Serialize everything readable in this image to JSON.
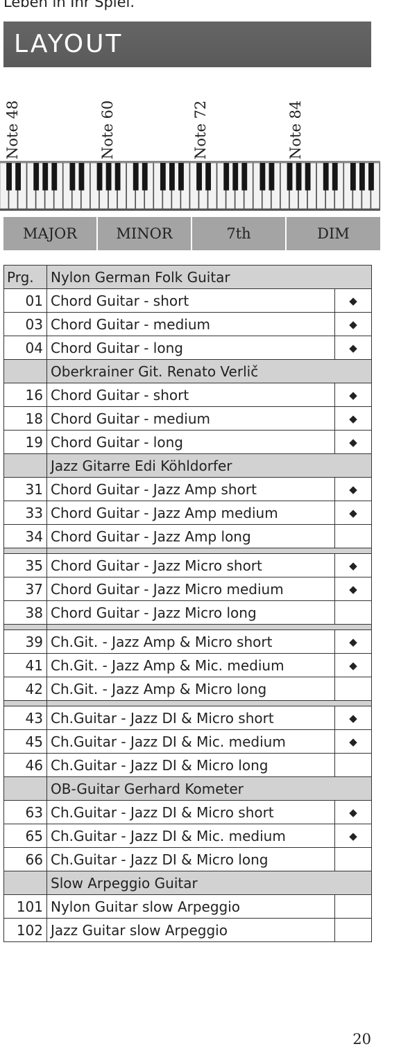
{
  "intro_text": "Leben in Ihr Spiel.",
  "section_title": "LAYOUT",
  "notes": [
    "Note 48",
    "Note 60",
    "Note 72",
    "Note 84"
  ],
  "chord_buttons": [
    "MAJOR",
    "MINOR",
    "7th",
    "DIM"
  ],
  "table": {
    "header": {
      "col1": "Prg.",
      "col2": "Nylon German Folk Guitar"
    },
    "marker": "◆",
    "rows": [
      {
        "type": "item",
        "prg": "01",
        "name": "Chord Guitar - short",
        "mark": true
      },
      {
        "type": "item",
        "prg": "03",
        "name": "Chord Guitar - medium",
        "mark": true
      },
      {
        "type": "item",
        "prg": "04",
        "name": "Chord Guitar - long",
        "mark": true
      },
      {
        "type": "section",
        "name": "Oberkrainer Git. Renato Verlič"
      },
      {
        "type": "item",
        "prg": "16",
        "name": "Chord Guitar - short",
        "mark": true
      },
      {
        "type": "item",
        "prg": "18",
        "name": "Chord Guitar - medium",
        "mark": true
      },
      {
        "type": "item",
        "prg": "19",
        "name": "Chord Guitar - long",
        "mark": true
      },
      {
        "type": "section",
        "name": "Jazz Gitarre Edi Köhldorfer"
      },
      {
        "type": "item",
        "prg": "31",
        "name": "Chord Guitar - Jazz Amp short",
        "mark": true
      },
      {
        "type": "item",
        "prg": "33",
        "name": "Chord Guitar - Jazz Amp medium",
        "mark": true
      },
      {
        "type": "item",
        "prg": "34",
        "name": "Chord Guitar - Jazz Amp long",
        "mark": false
      },
      {
        "type": "gap"
      },
      {
        "type": "item",
        "prg": "35",
        "name": "Chord Guitar - Jazz Micro short",
        "mark": true
      },
      {
        "type": "item",
        "prg": "37",
        "name": "Chord Guitar - Jazz Micro medium",
        "mark": true
      },
      {
        "type": "item",
        "prg": "38",
        "name": "Chord Guitar - Jazz Micro long",
        "mark": false
      },
      {
        "type": "gap"
      },
      {
        "type": "item",
        "prg": "39",
        "name": "Ch.Git. - Jazz Amp & Micro short",
        "mark": true
      },
      {
        "type": "item",
        "prg": "41",
        "name": "Ch.Git. - Jazz Amp & Mic. medium",
        "mark": true
      },
      {
        "type": "item",
        "prg": "42",
        "name": "Ch.Git. - Jazz Amp & Micro long",
        "mark": false
      },
      {
        "type": "gap"
      },
      {
        "type": "item",
        "prg": "43",
        "name": "Ch.Guitar - Jazz DI & Micro short",
        "mark": true
      },
      {
        "type": "item",
        "prg": "45",
        "name": "Ch.Guitar - Jazz DI & Mic. medium",
        "mark": true
      },
      {
        "type": "item",
        "prg": "46",
        "name": "Ch.Guitar - Jazz DI & Micro long",
        "mark": false
      },
      {
        "type": "section",
        "name": "OB-Guitar Gerhard Kometer"
      },
      {
        "type": "item",
        "prg": "63",
        "name": "Ch.Guitar - Jazz DI & Micro short",
        "mark": true
      },
      {
        "type": "item",
        "prg": "65",
        "name": "Ch.Guitar - Jazz DI & Mic. medium",
        "mark": true
      },
      {
        "type": "item",
        "prg": "66",
        "name": "Ch.Guitar - Jazz DI & Micro long",
        "mark": false
      },
      {
        "type": "section",
        "name": "Slow Arpeggio Guitar"
      },
      {
        "type": "item",
        "prg": "101",
        "name": "Nylon Guitar slow Arpeggio",
        "mark": false
      },
      {
        "type": "item",
        "prg": "102",
        "name": "Jazz Guitar slow Arpeggio",
        "mark": false
      }
    ]
  },
  "page_number": "20"
}
